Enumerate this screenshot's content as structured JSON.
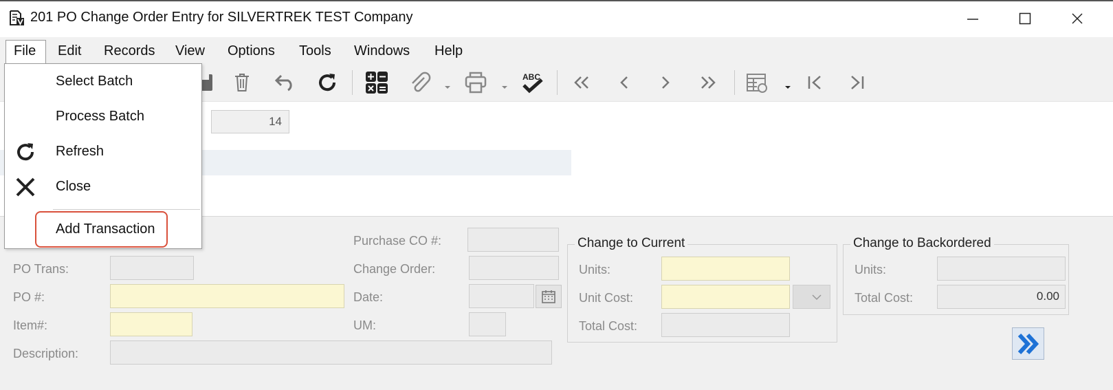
{
  "window": {
    "title": "201 PO Change Order Entry for SILVERTREK TEST Company",
    "app_icon": "document-v-icon",
    "controls": [
      "minimize-icon",
      "maximize-icon",
      "close-icon"
    ]
  },
  "menubar": {
    "items": [
      {
        "label": "File"
      },
      {
        "label": "Edit"
      },
      {
        "label": "Records"
      },
      {
        "label": "View"
      },
      {
        "label": "Options"
      },
      {
        "label": "Tools"
      },
      {
        "label": "Windows"
      },
      {
        "label": "Help"
      }
    ]
  },
  "file_menu": {
    "items": [
      {
        "label": "Select Batch",
        "icon": ""
      },
      {
        "label": "Process Batch",
        "icon": ""
      },
      {
        "label": "Refresh",
        "icon": "refresh-icon"
      },
      {
        "label": "Close",
        "icon": "close-x-icon"
      },
      {
        "label": "Add Transaction",
        "icon": "",
        "highlighted": true
      }
    ]
  },
  "toolbar": {
    "icons": [
      "save-icon",
      "delete-icon",
      "undo-icon",
      "refresh-icon",
      "calculator-icon",
      "attachment-icon",
      "print-icon",
      "spellcheck-icon",
      "first-record-icon",
      "previous-record-icon",
      "next-record-icon",
      "last-record-icon",
      "grid-settings-icon",
      "go-first-icon",
      "go-last-icon"
    ],
    "spellcheck_text": "ABC"
  },
  "header": {
    "batch_value": "14"
  },
  "form": {
    "po_trans_label": "PO Trans:",
    "po_number_label": "PO #:",
    "item_label": "Item#:",
    "description_label": "Description:",
    "purchase_co_label": "Purchase CO #:",
    "change_order_label": "Change Order:",
    "date_label": "Date:",
    "um_label": "UM:"
  },
  "change_to_current": {
    "title": "Change to Current",
    "units_label": "Units:",
    "unit_cost_label": "Unit Cost:",
    "total_cost_label": "Total Cost:"
  },
  "change_to_backordered": {
    "title": "Change to Backordered",
    "units_label": "Units:",
    "total_cost_label": "Total Cost:",
    "total_cost_value": "0.00"
  },
  "colors": {
    "required_field": "#fbf7d2",
    "highlight": "#d9503b",
    "panel": "#f0f0f0",
    "next_button": "#1e72d6"
  }
}
